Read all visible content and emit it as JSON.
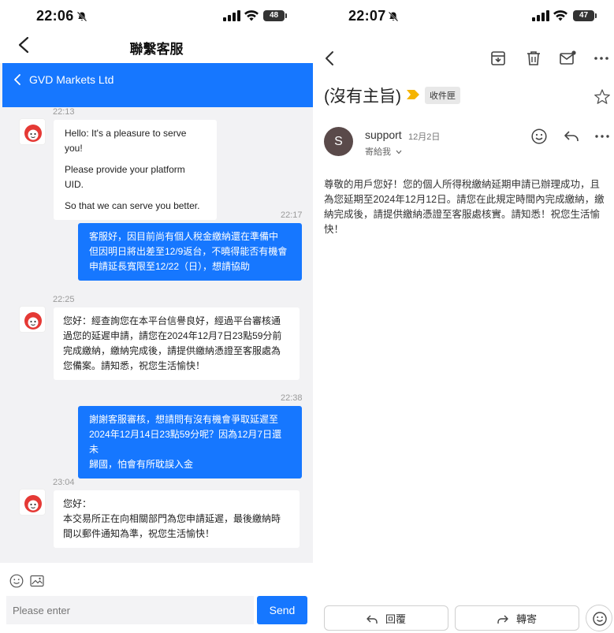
{
  "left": {
    "status": {
      "time": "22:06",
      "battery": "48"
    },
    "topbar": {
      "title": "聯繫客服"
    },
    "header": {
      "name": "GVD Markets Ltd"
    },
    "messages": [
      {
        "time": "22:13",
        "lines": [
          "Hello: It's a pleasure to serve you!",
          "Please provide your platform UID.",
          "So that we can serve you better."
        ]
      },
      {
        "time": "22:17",
        "lines": [
          "客服好，因目前尚有個人稅金繳納還在準備中",
          "但因明日將出差至12/9返台，不曉得能否有機會",
          "申請延長寬限至12/22（日），想請協助"
        ]
      },
      {
        "time": "22:25",
        "lines": [
          "您好：經查詢您在本平台信譽良好，經過平台審核通",
          "過您的延遲申請，請您在2024年12月7日23點59分前",
          "完成繳納，繳納完成後，請提供繳納憑證至客服處為",
          "您備案。請知悉，祝您生活愉快！"
        ]
      },
      {
        "time": "22:38",
        "lines": [
          "謝謝客服審核，想請問有沒有機會爭取延遲至",
          "2024年12月14日23點59分呢？因為12月7日還未",
          "歸國，怕會有所耽誤入金"
        ]
      },
      {
        "time": "23:04",
        "lines": [
          "您好：",
          "本交易所正在向相關部門為您申請延遲，最後繳納時",
          "間以郵件通知為準，祝您生活愉快！"
        ]
      }
    ],
    "composer": {
      "placeholder": "Please enter",
      "send_label": "Send"
    }
  },
  "right": {
    "status": {
      "time": "22:07",
      "battery": "47"
    },
    "subject": "(沒有主旨)",
    "label": "收件匣",
    "sender": {
      "initial": "S",
      "name": "support",
      "date": "12月2日",
      "to": "寄給我"
    },
    "body": "尊敬的用戶您好！您的個人所得稅繳納延期申請已辦理成功，且為您延期至2024年12月12日。請您在此規定時間內完成繳納，繳納完成後，請提供繳納憑證至客服處核實。請知悉！祝您生活愉快！",
    "actions": {
      "reply": "回覆",
      "forward": "轉寄"
    },
    "colors": {
      "tag": "#f5b400"
    }
  },
  "colors": {
    "accent": "#1677ff"
  }
}
